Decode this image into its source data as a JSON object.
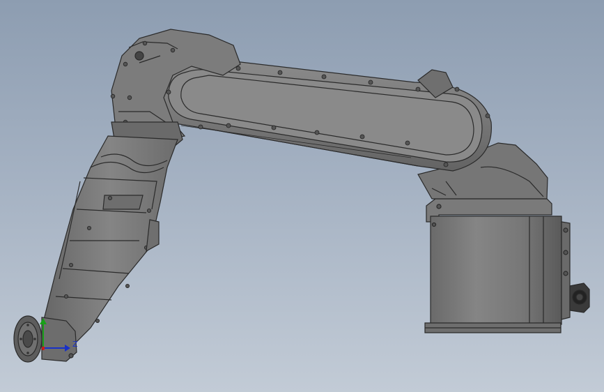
{
  "triad": {
    "z_label": "Z",
    "x_color": "#d01818",
    "y_color": "#18a018",
    "z_color": "#1830c8"
  },
  "colors": {
    "background_top": "#8d9db1",
    "background_bottom": "#c2cbd6",
    "body_dark": "#5e5e5e",
    "body_mid": "#7a7a7a",
    "body_light": "#9a9a9a",
    "edge": "#2a2a2a"
  }
}
